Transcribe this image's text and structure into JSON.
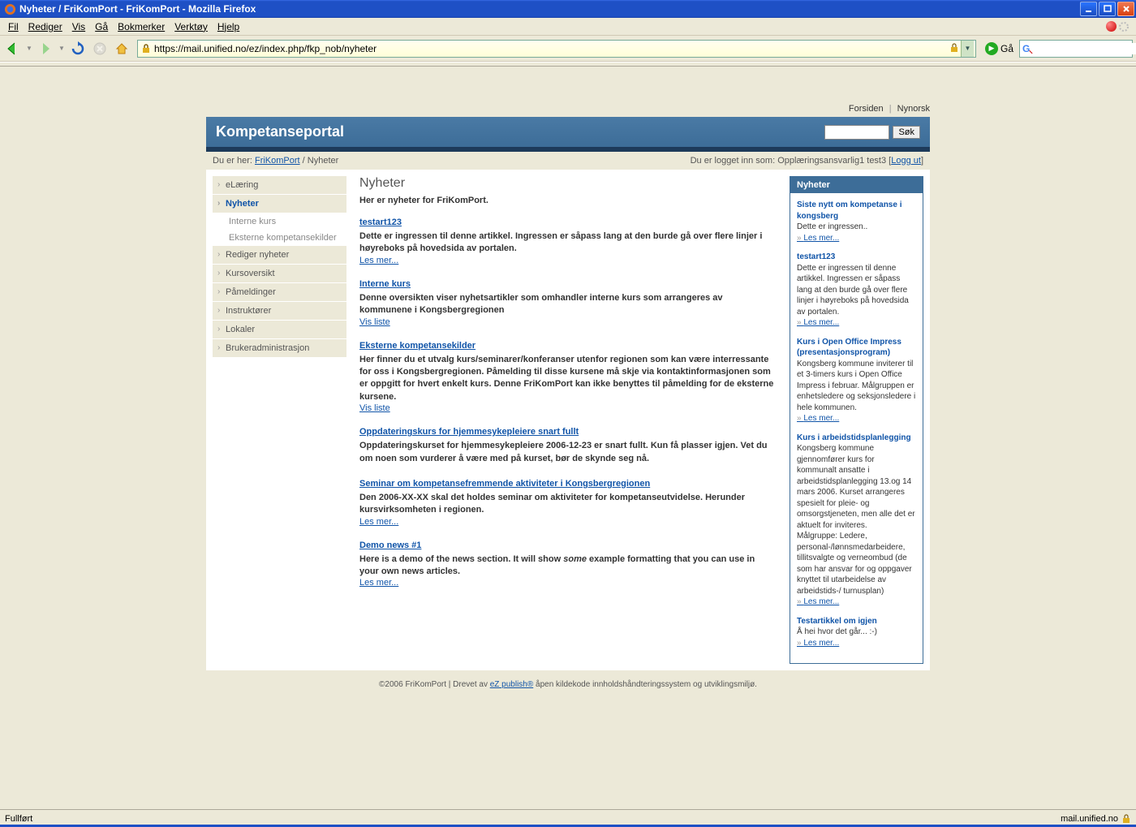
{
  "window": {
    "title": "Nyheter / FriKomPort - FriKomPort - Mozilla Firefox"
  },
  "menus": {
    "fil": "Fil",
    "rediger": "Rediger",
    "vis": "Vis",
    "ga": "Gå",
    "bokmerker": "Bokmerker",
    "verktoy": "Verktøy",
    "hjelp": "Hjelp"
  },
  "url": "https://mail.unified.no/ez/index.php/fkp_nob/nyheter",
  "go_label": "Gå",
  "toplinks": {
    "forsiden": "Forsiden",
    "nynorsk": "Nynorsk"
  },
  "site": {
    "title": "Kompetanseportal",
    "search_btn": "Søk"
  },
  "crumb": {
    "prefix": "Du er her:",
    "link": "FriKomPort",
    "sep": " / ",
    "current": "Nyheter",
    "login_prefix": "Du er logget inn som: ",
    "user": "Opplæringsansvarlig1 test3",
    "logout": "Logg ut"
  },
  "leftnav": [
    {
      "label": "eLæring",
      "key": "elaring"
    },
    {
      "label": "Nyheter",
      "key": "nyheter",
      "active": true
    },
    {
      "label": "Interne kurs",
      "key": "interne",
      "sub": true
    },
    {
      "label": "Eksterne kompetansekilder",
      "key": "eksterne",
      "sub": true
    },
    {
      "label": "Rediger nyheter",
      "key": "rediger"
    },
    {
      "label": "Kursoversikt",
      "key": "kursoversikt"
    },
    {
      "label": "Påmeldinger",
      "key": "pameldinger"
    },
    {
      "label": "Instruktører",
      "key": "instruktorer"
    },
    {
      "label": "Lokaler",
      "key": "lokaler"
    },
    {
      "label": "Brukeradministrasjon",
      "key": "brukeradmin"
    }
  ],
  "main": {
    "heading": "Nyheter",
    "intro": "Her er nyheter for FriKomPort.",
    "items": [
      {
        "title": "testart123",
        "body": "Dette er ingressen til denne artikkel. Ingressen er såpass lang at den burde gå over flere linjer i høyreboks på hovedsida av portalen.",
        "more": "Les mer..."
      },
      {
        "title": "Interne kurs",
        "body": "Denne oversikten viser nyhetsartikler som omhandler interne kurs som arrangeres av kommunene i Kongsbergregionen",
        "more": "Vis liste"
      },
      {
        "title": "Eksterne kompetansekilder",
        "body": "Her finner du et utvalg kurs/seminarer/konferanser utenfor regionen som kan være interressante for oss i Kongsbergregionen. Påmelding til disse kursene må skje via kontaktinformasjonen som er oppgitt for hvert enkelt kurs. Denne FriKomPort kan ikke benyttes til påmelding for de eksterne kursene.",
        "more": "Vis liste"
      },
      {
        "title": "Oppdateringskurs for hjemmesykepleiere snart fullt",
        "body": "Oppdateringskurset for hjemmesykepleiere 2006-12-23 er snart fullt. Kun få plasser igjen. Vet du om noen som vurderer å være med på kurset, bør de skynde seg nå."
      },
      {
        "title": "Seminar om kompetansefremmende aktiviteter i Kongsbergregionen",
        "body": "Den 2006-XX-XX skal det holdes seminar om aktiviteter for kompetanseutvidelse. Herunder kursvirksomheten i regionen.",
        "more": "Les mer..."
      },
      {
        "title": "Demo news #1",
        "body_pre": "Here is a demo of the news section. It will show ",
        "body_em": "some",
        "body_post": " example formatting that you can use in your own news articles.",
        "more": "Les mer..."
      }
    ]
  },
  "rightbox": {
    "title": "Nyheter",
    "items": [
      {
        "title": "Siste nytt om kompetanse i kongsberg",
        "text": "Dette er ingressen..",
        "more": "Les mer..."
      },
      {
        "title": "testart123",
        "text": "Dette er ingressen til denne artikkel. Ingressen er såpass lang at den burde gå over flere linjer i høyreboks på hovedsida av portalen.",
        "more": "Les mer..."
      },
      {
        "title": "Kurs i Open Office Impress (presentasjonsprogram)",
        "text": "Kongsberg kommune inviterer til et 3-timers kurs i Open Office Impress i februar. Målgruppen er enhetsledere og seksjonsledere i hele kommunen.",
        "more": "Les mer..."
      },
      {
        "title": "Kurs i arbeidstidsplanlegging",
        "text": "Kongsberg kommune gjennomfører kurs for kommunalt ansatte i arbeidstidsplanlegging 13.og 14 mars 2006. Kurset arrangeres spesielt for pleie- og omsorgstjeneten, men alle det er aktuelt for inviteres.\nMålgruppe: Ledere, personal-/lønnsmedarbeidere, tillitsvalgte og verneombud (de som har ansvar for og oppgaver knyttet til utarbeidelse av arbeidstids-/ turnusplan)",
        "more": "Les mer..."
      },
      {
        "title": "Testartikkel om igjen",
        "text": "Å hei hvor det går... :-)",
        "more": "Les mer..."
      }
    ]
  },
  "footer": {
    "pre": "©2006 FriKomPort | Drevet av ",
    "link": "eZ publish®",
    "post": " åpen kildekode innholdshåndteringssystem og utviklingsmiljø."
  },
  "status": {
    "left": "Fullført",
    "right": "mail.unified.no"
  }
}
